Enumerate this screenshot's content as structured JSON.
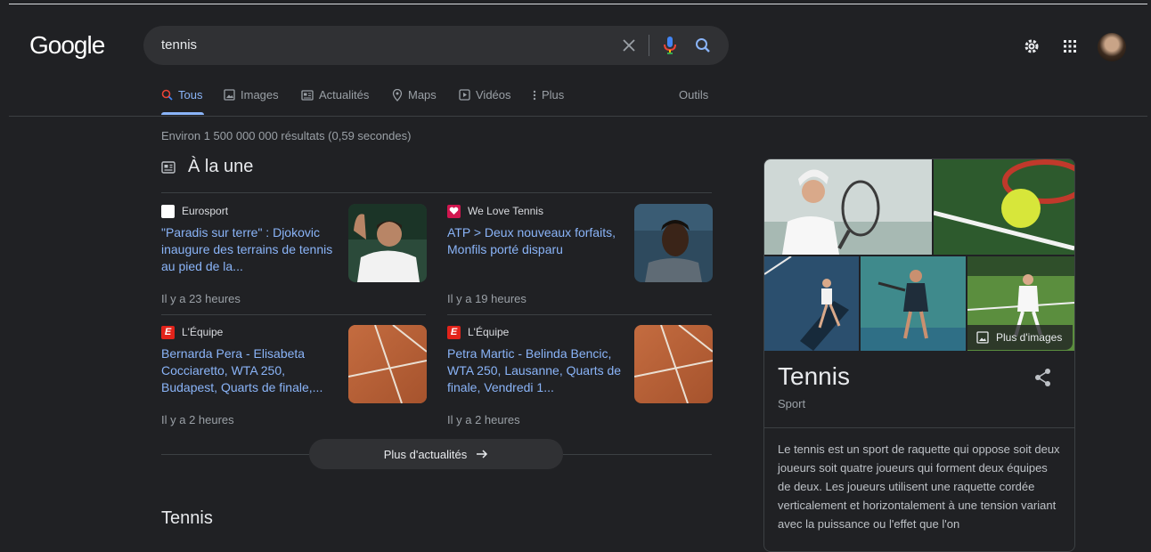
{
  "header": {
    "logo_text": "Google",
    "search_query": "tennis"
  },
  "tabs": [
    {
      "label": "Tous",
      "icon": "search-icon",
      "active": true
    },
    {
      "label": "Images",
      "icon": "image-icon",
      "active": false
    },
    {
      "label": "Actualités",
      "icon": "news-icon",
      "active": false
    },
    {
      "label": "Maps",
      "icon": "map-pin-icon",
      "active": false
    },
    {
      "label": "Vidéos",
      "icon": "video-icon",
      "active": false
    },
    {
      "label": "Plus",
      "icon": "more-vertical-icon",
      "active": false
    }
  ],
  "tools_label": "Outils",
  "result_stats": "Environ 1 500 000 000 résultats (0,59 secondes)",
  "top_stories": {
    "title": "À la une",
    "items": [
      {
        "source": "Eurosport",
        "title": "\"Paradis sur terre\" : Djokovic inaugure des terrains de tennis au pied de la...",
        "time": "Il y a 23 heures",
        "thumb": "djokovic"
      },
      {
        "source": "We Love Tennis",
        "title": "ATP > Deux nouveaux forfaits, Monfils porté disparu",
        "time": "Il y a 19 heures",
        "thumb": "monfils"
      },
      {
        "source": "L'Équipe",
        "title": "Bernarda Pera - Elisabeta Cocciaretto, WTA 250, Budapest, Quarts de finale,...",
        "time": "Il y a 2 heures",
        "thumb": "clay"
      },
      {
        "source": "L'Équipe",
        "title": "Petra Martic - Belinda Bencic, WTA 250, Lausanne, Quarts de finale, Vendredi 1...",
        "time": "Il y a 2 heures",
        "thumb": "clay"
      }
    ],
    "more_label": "Plus d'actualités"
  },
  "next_result_title": "Tennis",
  "knowledge_panel": {
    "title": "Tennis",
    "subtitle": "Sport",
    "more_images_label": "Plus d'images",
    "description": "Le tennis est un sport de raquette qui oppose soit deux joueurs soit quatre joueurs qui forment deux équipes de deux. Les joueurs utilisent une raquette cordée verticalement et horizontalement à une tension variant avec la puissance ou l'effet que l'on"
  },
  "colors": {
    "background": "#202124",
    "link": "#8ab4f8",
    "surface": "#303134"
  }
}
